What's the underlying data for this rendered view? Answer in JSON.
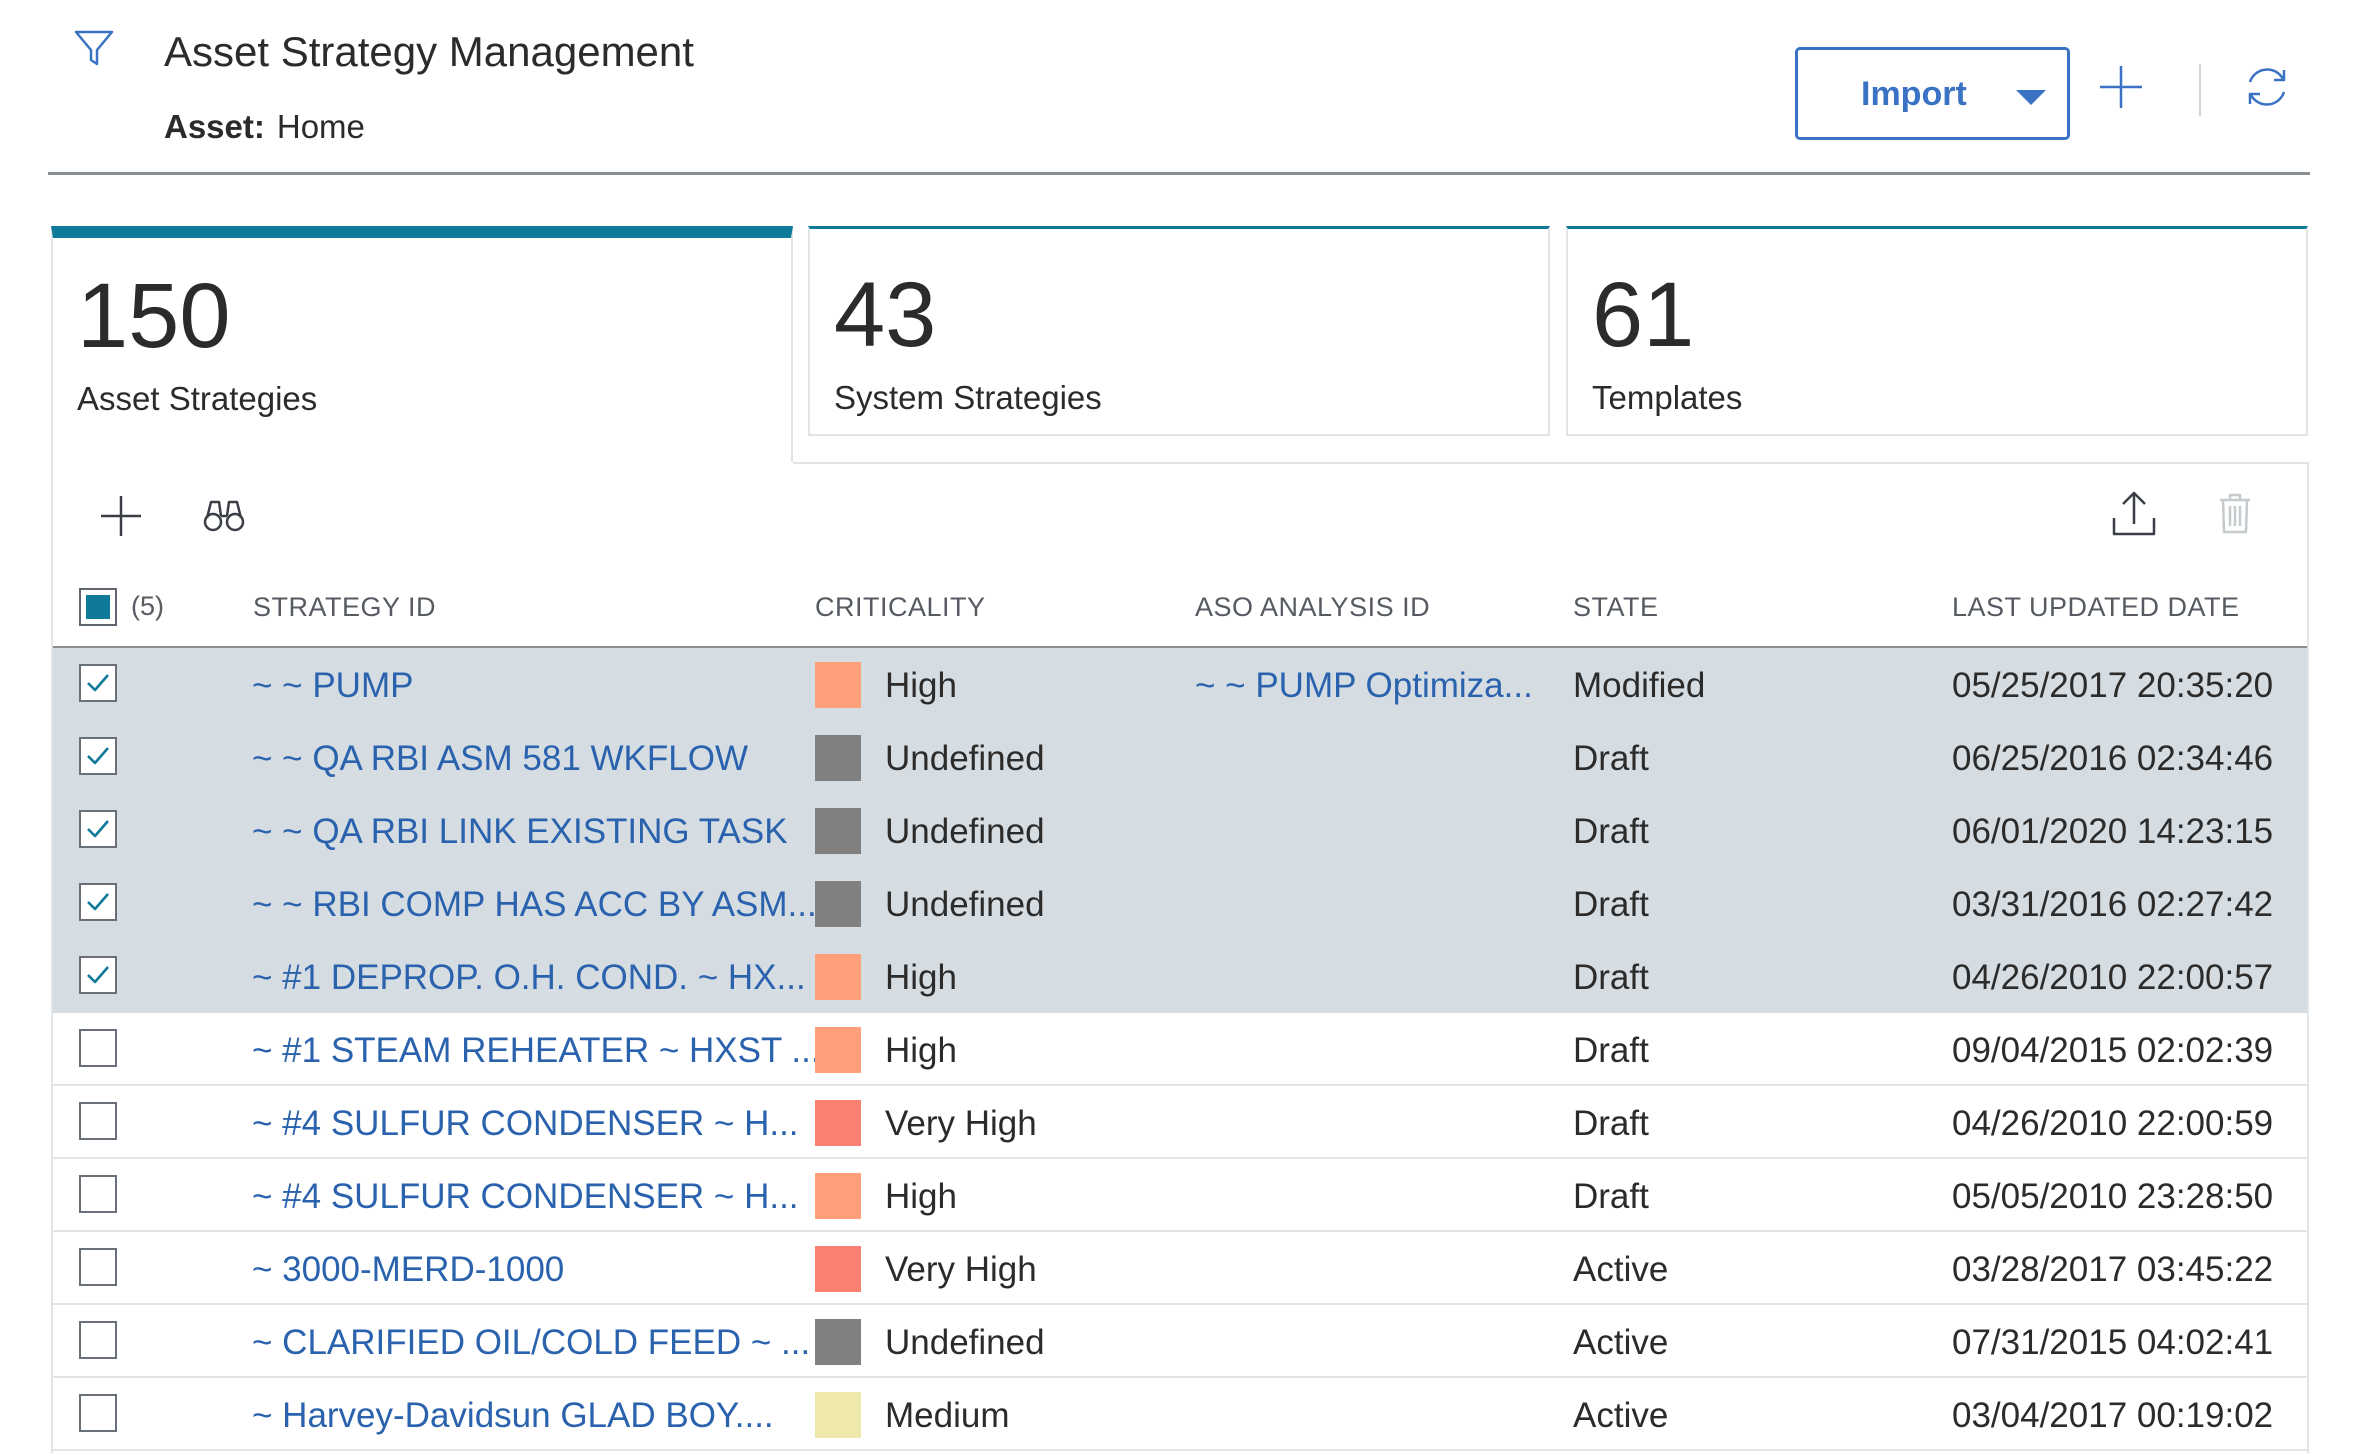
{
  "header": {
    "title": "Asset Strategy Management",
    "asset_label": "Asset:",
    "asset_value": "Home",
    "import_label": "Import"
  },
  "cards": [
    {
      "count": "150",
      "label": "Asset Strategies",
      "active": true
    },
    {
      "count": "43",
      "label": "System Strategies",
      "active": false
    },
    {
      "count": "61",
      "label": "Templates",
      "active": false
    }
  ],
  "table": {
    "selected_count": "(5)",
    "columns": [
      "STRATEGY ID",
      "CRITICALITY",
      "ASO ANALYSIS ID",
      "STATE",
      "LAST UPDATED DATE"
    ],
    "rows": [
      {
        "selected": true,
        "strategy_id": "~ ~ PUMP",
        "criticality": "High",
        "aso_id": "~ ~ PUMP Optimiza...",
        "state": "Modified",
        "updated": "05/25/2017 20:35:20"
      },
      {
        "selected": true,
        "strategy_id": "~ ~ QA RBI ASM 581 WKFLOW",
        "criticality": "Undefined",
        "aso_id": "",
        "state": "Draft",
        "updated": "06/25/2016 02:34:46"
      },
      {
        "selected": true,
        "strategy_id": "~ ~ QA RBI LINK EXISTING TASK",
        "criticality": "Undefined",
        "aso_id": "",
        "state": "Draft",
        "updated": "06/01/2020 14:23:15"
      },
      {
        "selected": true,
        "strategy_id": "~ ~ RBI COMP HAS ACC BY ASM...",
        "criticality": "Undefined",
        "aso_id": "",
        "state": "Draft",
        "updated": "03/31/2016 02:27:42"
      },
      {
        "selected": true,
        "strategy_id": "~ #1 DEPROP. O.H. COND. ~ HX...",
        "criticality": "High",
        "aso_id": "",
        "state": "Draft",
        "updated": "04/26/2010 22:00:57"
      },
      {
        "selected": false,
        "strategy_id": "~ #1 STEAM REHEATER ~ HXST ...",
        "criticality": "High",
        "aso_id": "",
        "state": "Draft",
        "updated": "09/04/2015 02:02:39"
      },
      {
        "selected": false,
        "strategy_id": "~ #4 SULFUR CONDENSER ~ H...",
        "criticality": "Very High",
        "aso_id": "",
        "state": "Draft",
        "updated": "04/26/2010 22:00:59"
      },
      {
        "selected": false,
        "strategy_id": "~ #4 SULFUR CONDENSER ~ H...",
        "criticality": "High",
        "aso_id": "",
        "state": "Draft",
        "updated": "05/05/2010 23:28:50"
      },
      {
        "selected": false,
        "strategy_id": "~ 3000-MERD-1000",
        "criticality": "Very High",
        "aso_id": "",
        "state": "Active",
        "updated": "03/28/2017 03:45:22"
      },
      {
        "selected": false,
        "strategy_id": "~ CLARIFIED OIL/COLD FEED ~ ...",
        "criticality": "Undefined",
        "aso_id": "",
        "state": "Active",
        "updated": "07/31/2015 04:02:41"
      },
      {
        "selected": false,
        "strategy_id": "~ Harvey-Davidsun GLAD BOY....",
        "criticality": "Medium",
        "aso_id": "",
        "state": "Active",
        "updated": "03/04/2017 00:19:02"
      }
    ]
  },
  "criticality_colors": {
    "High": "#ffa07a",
    "Undefined": "#808080",
    "Very High": "#fa8072",
    "Medium": "#eee8aa"
  },
  "colors": {
    "accent": "#0e7a98",
    "link": "#2a62ad",
    "selected_row": "#d5dde3"
  },
  "icons": {
    "header": [
      "filter-icon",
      "plus-icon",
      "refresh-icon"
    ],
    "toolbar": [
      "plus-icon",
      "binoculars-icon",
      "export-icon",
      "trash-icon"
    ]
  }
}
